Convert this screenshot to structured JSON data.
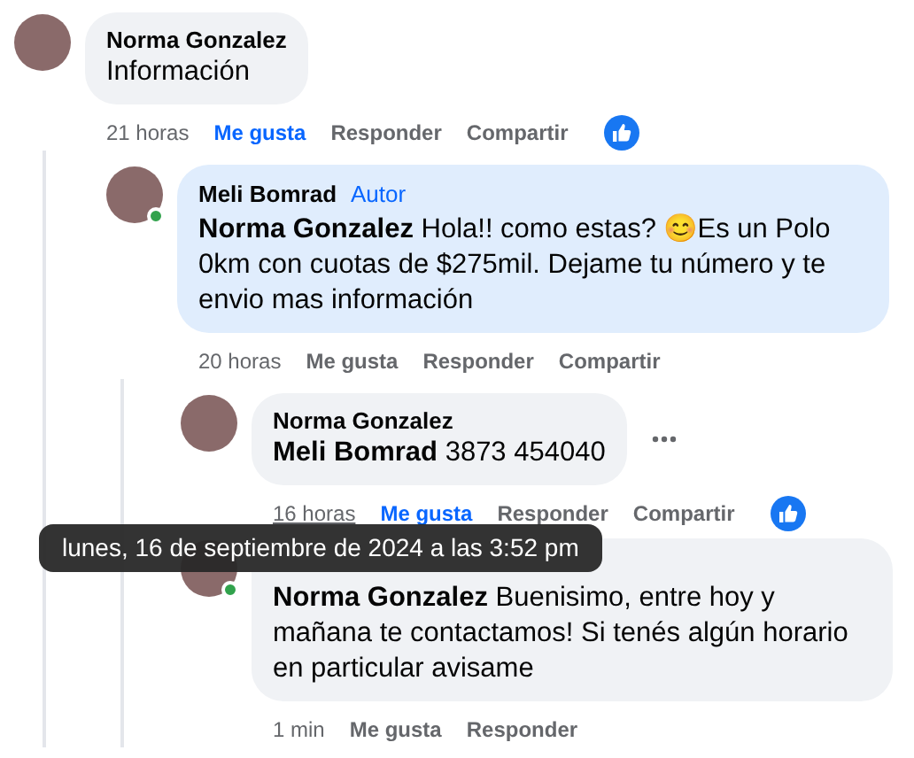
{
  "comments": [
    {
      "author": "Norma Gonzalez",
      "text": "Información",
      "highlighted": false,
      "time": "21 horas",
      "liked": true,
      "actions": [
        "Me gusta",
        "Responder",
        "Compartir"
      ],
      "reaction": true,
      "replies": [
        {
          "author": "Meli Bomrad",
          "badge": "Autor",
          "text": "**Norma Gonzalez** Hola!! como estas? 😊Es un Polo 0km con cuotas de $275mil. Dejame tu número y te envio mas información",
          "online": true,
          "highlighted": true,
          "time": "20 horas",
          "liked": false,
          "actions": [
            "Me gusta",
            "Responder",
            "Compartir"
          ],
          "replies": [
            {
              "author": "Norma Gonzalez",
              "text": "**Meli Bomrad** 3873 454040",
              "highlighted": false,
              "time": "16 horas",
              "hovered": true,
              "tooltip": "lunes, 16 de septiembre de 2024 a las 3:52 pm",
              "liked": true,
              "actions": [
                "Me gusta",
                "Responder",
                "Compartir"
              ],
              "reaction": true,
              "more": true
            },
            {
              "text": "**Norma Gonzalez** Buenisimo, entre hoy y mañana te contactamos! Si tenés algún horario en particular avisame",
              "online": true,
              "highlighted": false,
              "time": "1 min",
              "liked": false,
              "actions": [
                "Me gusta",
                "Responder"
              ]
            }
          ]
        }
      ]
    }
  ]
}
